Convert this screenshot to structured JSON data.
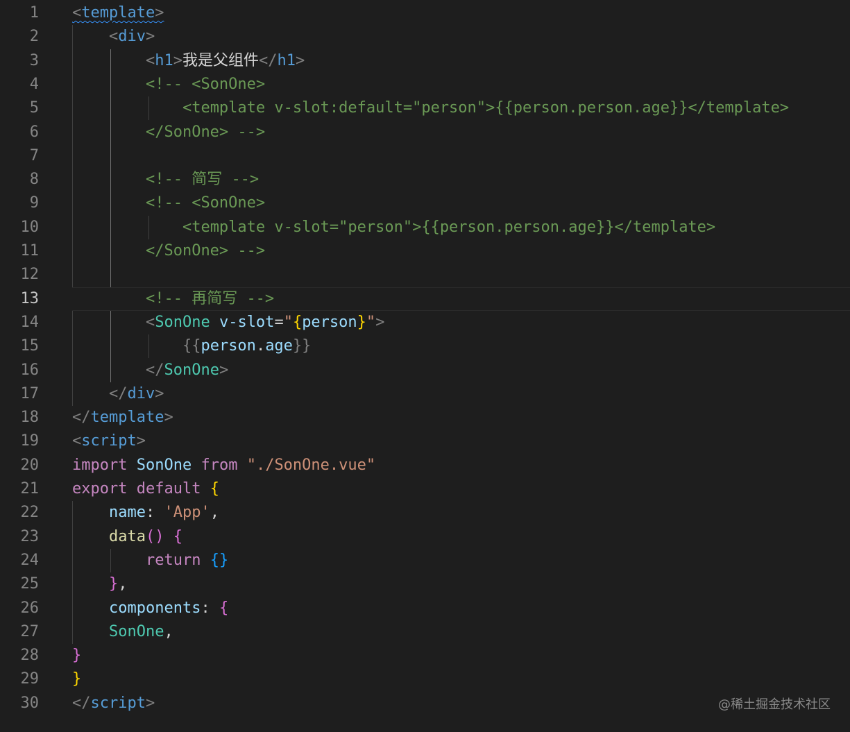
{
  "editor": {
    "active_line": 13,
    "lines": [
      {
        "n": "1",
        "segs": [
          [
            "c-bracket squiggle",
            "<"
          ],
          [
            "c-tag squiggle",
            "template"
          ],
          [
            "c-bracket squiggle",
            ">"
          ]
        ]
      },
      {
        "n": "2",
        "segs": [
          [
            "t",
            "    "
          ],
          [
            "c-bracket",
            "<"
          ],
          [
            "c-tag",
            "div"
          ],
          [
            "c-bracket",
            ">"
          ]
        ]
      },
      {
        "n": "3",
        "segs": [
          [
            "t",
            "        "
          ],
          [
            "c-bracket",
            "<"
          ],
          [
            "c-tag",
            "h1"
          ],
          [
            "c-bracket",
            ">"
          ],
          [
            "c-text",
            "我是父组件"
          ],
          [
            "c-bracket",
            "</"
          ],
          [
            "c-tag",
            "h1"
          ],
          [
            "c-bracket",
            ">"
          ]
        ]
      },
      {
        "n": "4",
        "segs": [
          [
            "t",
            "        "
          ],
          [
            "c-comment",
            "<!-- <SonOne>"
          ]
        ]
      },
      {
        "n": "5",
        "segs": [
          [
            "t",
            "            "
          ],
          [
            "c-comment",
            "<template v-slot:default=\"person\">{{person.person.age}}</template>"
          ]
        ]
      },
      {
        "n": "6",
        "segs": [
          [
            "t",
            "        "
          ],
          [
            "c-comment",
            "</SonOne> -->"
          ]
        ]
      },
      {
        "n": "7",
        "segs": []
      },
      {
        "n": "8",
        "segs": [
          [
            "t",
            "        "
          ],
          [
            "c-comment",
            "<!-- 简写 -->"
          ]
        ]
      },
      {
        "n": "9",
        "segs": [
          [
            "t",
            "        "
          ],
          [
            "c-comment",
            "<!-- <SonOne>"
          ]
        ]
      },
      {
        "n": "10",
        "segs": [
          [
            "t",
            "            "
          ],
          [
            "c-comment",
            "<template v-slot=\"person\">{{person.person.age}}</template>"
          ]
        ]
      },
      {
        "n": "11",
        "segs": [
          [
            "t",
            "        "
          ],
          [
            "c-comment",
            "</SonOne> -->"
          ]
        ]
      },
      {
        "n": "12",
        "segs": []
      },
      {
        "n": "13",
        "segs": [
          [
            "t",
            "        "
          ],
          [
            "c-comment",
            "<!-- 再简写 -->"
          ]
        ]
      },
      {
        "n": "14",
        "segs": [
          [
            "t",
            "        "
          ],
          [
            "c-bracket",
            "<"
          ],
          [
            "c-comp",
            "SonOne"
          ],
          [
            "t",
            " "
          ],
          [
            "c-attr",
            "v-slot"
          ],
          [
            "c-text",
            "="
          ],
          [
            "c-str",
            "\""
          ],
          [
            "c-b1",
            "{"
          ],
          [
            "c-var",
            "person"
          ],
          [
            "c-b1",
            "}"
          ],
          [
            "c-str",
            "\""
          ],
          [
            "c-bracket",
            ">"
          ]
        ]
      },
      {
        "n": "15",
        "segs": [
          [
            "t",
            "            "
          ],
          [
            "c-bracket",
            "{{"
          ],
          [
            "c-var",
            "person"
          ],
          [
            "c-text",
            "."
          ],
          [
            "c-var",
            "age"
          ],
          [
            "c-bracket",
            "}}"
          ]
        ]
      },
      {
        "n": "16",
        "segs": [
          [
            "t",
            "        "
          ],
          [
            "c-bracket",
            "</"
          ],
          [
            "c-comp",
            "SonOne"
          ],
          [
            "c-bracket",
            ">"
          ]
        ]
      },
      {
        "n": "17",
        "segs": [
          [
            "t",
            "    "
          ],
          [
            "c-bracket",
            "</"
          ],
          [
            "c-tag",
            "div"
          ],
          [
            "c-bracket",
            ">"
          ]
        ]
      },
      {
        "n": "18",
        "segs": [
          [
            "c-bracket",
            "</"
          ],
          [
            "c-tag",
            "template"
          ],
          [
            "c-bracket",
            ">"
          ]
        ]
      },
      {
        "n": "19",
        "segs": [
          [
            "c-bracket",
            "<"
          ],
          [
            "c-tag",
            "script"
          ],
          [
            "c-bracket",
            ">"
          ]
        ]
      },
      {
        "n": "20",
        "segs": [
          [
            "c-kw",
            "import"
          ],
          [
            "t",
            " "
          ],
          [
            "c-var",
            "SonOne"
          ],
          [
            "t",
            " "
          ],
          [
            "c-kw",
            "from"
          ],
          [
            "t",
            " "
          ],
          [
            "c-str",
            "\"./SonOne.vue\""
          ]
        ]
      },
      {
        "n": "21",
        "segs": [
          [
            "c-kw",
            "export"
          ],
          [
            "t",
            " "
          ],
          [
            "c-kw",
            "default"
          ],
          [
            "t",
            " "
          ],
          [
            "c-b1",
            "{"
          ]
        ]
      },
      {
        "n": "22",
        "segs": [
          [
            "t",
            "    "
          ],
          [
            "c-var",
            "name"
          ],
          [
            "c-text",
            ": "
          ],
          [
            "c-str",
            "'App'"
          ],
          [
            "c-text",
            ","
          ]
        ]
      },
      {
        "n": "23",
        "segs": [
          [
            "t",
            "    "
          ],
          [
            "c-fn",
            "data"
          ],
          [
            "c-b2",
            "()"
          ],
          [
            "t",
            " "
          ],
          [
            "c-b2",
            "{"
          ]
        ]
      },
      {
        "n": "24",
        "segs": [
          [
            "t",
            "        "
          ],
          [
            "c-kw",
            "return"
          ],
          [
            "t",
            " "
          ],
          [
            "c-b3",
            "{}"
          ]
        ]
      },
      {
        "n": "25",
        "segs": [
          [
            "t",
            "    "
          ],
          [
            "c-b2",
            "}"
          ],
          [
            "c-text",
            ","
          ]
        ]
      },
      {
        "n": "26",
        "segs": [
          [
            "t",
            "    "
          ],
          [
            "c-var",
            "components"
          ],
          [
            "c-text",
            ": "
          ],
          [
            "c-b2",
            "{"
          ]
        ]
      },
      {
        "n": "27",
        "segs": [
          [
            "t",
            "    "
          ],
          [
            "c-comp",
            "SonOne"
          ],
          [
            "c-text",
            ","
          ]
        ]
      },
      {
        "n": "28",
        "segs": [
          [
            "c-b2",
            "}"
          ]
        ]
      },
      {
        "n": "29",
        "segs": [
          [
            "c-b1",
            "}"
          ]
        ]
      },
      {
        "n": "30",
        "segs": [
          [
            "c-bracket",
            "</"
          ],
          [
            "c-tag",
            "script"
          ],
          [
            "c-bracket",
            ">"
          ]
        ]
      }
    ]
  },
  "watermark": "@稀土掘金技术社区"
}
